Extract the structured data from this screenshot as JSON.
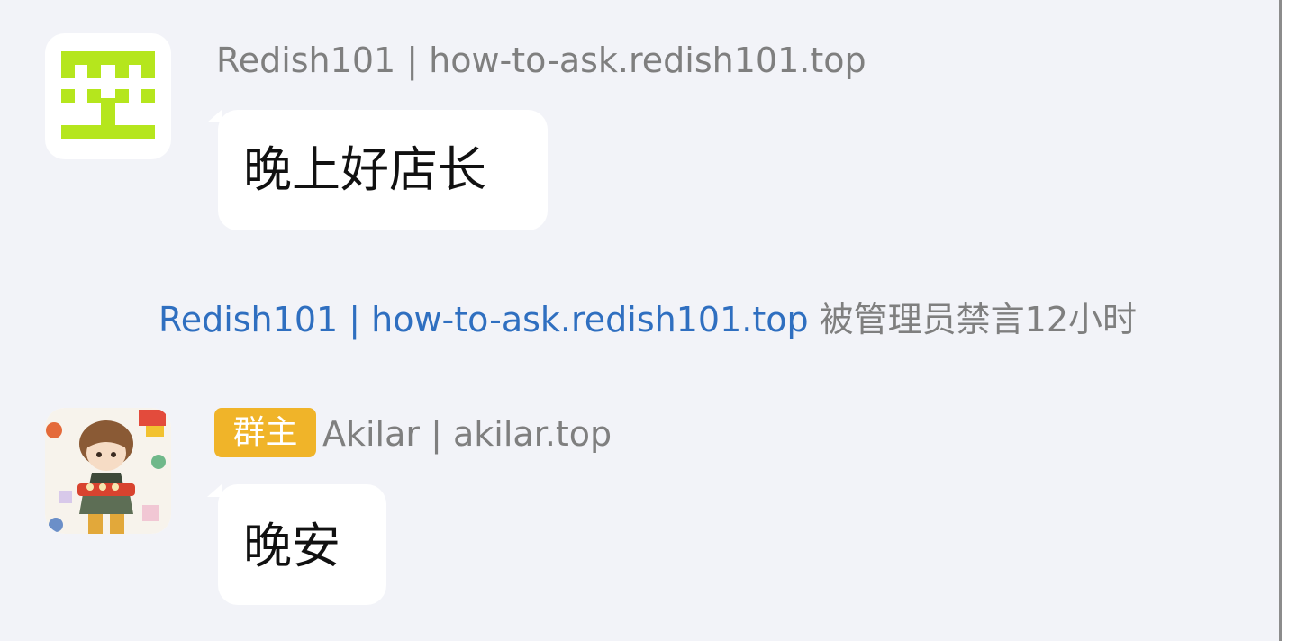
{
  "messages": [
    {
      "sender": "Redish101 | how-to-ask.redish101.top",
      "text": "晚上好店长",
      "avatar_icon": "pixel-face-icon",
      "avatar_color": "#b5e61d"
    },
    {
      "role_badge": "群主",
      "sender": "Akilar | akilar.top",
      "text": "晚安",
      "avatar_icon": "anime-boy-avatar-icon",
      "badge_color": "#f0b429"
    }
  ],
  "system_notice": {
    "user_link": "Redish101 | how-to-ask.redish101.top",
    "action": " 被管理员禁言12小时",
    "link_color": "#2f6fc0"
  }
}
